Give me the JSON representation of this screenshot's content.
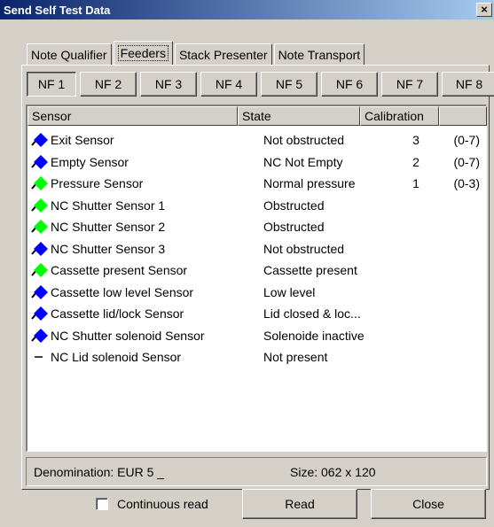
{
  "window": {
    "title": "Send Self Test Data",
    "close_glyph": "×"
  },
  "tabs": [
    {
      "label": "Note Qualifier",
      "active": false
    },
    {
      "label": "Feeders",
      "active": true
    },
    {
      "label": "Stack Presenter",
      "active": false
    },
    {
      "label": "Note Transport",
      "active": false
    }
  ],
  "feeders": [
    "NF 1",
    "NF 2",
    "NF 3",
    "NF 4",
    "NF 5",
    "NF 6",
    "NF 7",
    "NF 8"
  ],
  "selected_feeder": "NF 1",
  "columns": {
    "sensor": "Sensor",
    "state": "State",
    "calibration": "Calibration",
    "extra": ""
  },
  "rows": [
    {
      "icon": "blue-diamond-icon",
      "sensor": "Exit Sensor",
      "state": "Not obstructed",
      "calibration": "3",
      "range": "(0-7)"
    },
    {
      "icon": "blue-diamond-icon",
      "sensor": "Empty Sensor",
      "state": "NC Not Empty",
      "calibration": "2",
      "range": "(0-7)"
    },
    {
      "icon": "green-diamond-icon",
      "sensor": "Pressure Sensor",
      "state": "Normal pressure",
      "calibration": "1",
      "range": "(0-3)"
    },
    {
      "icon": "green-diamond-icon",
      "sensor": "NC Shutter Sensor 1",
      "state": "Obstructed",
      "calibration": "",
      "range": ""
    },
    {
      "icon": "green-diamond-icon",
      "sensor": "NC Shutter Sensor 2",
      "state": "Obstructed",
      "calibration": "",
      "range": ""
    },
    {
      "icon": "blue-diamond-icon",
      "sensor": "NC Shutter Sensor 3",
      "state": "Not obstructed",
      "calibration": "",
      "range": ""
    },
    {
      "icon": "green-diamond-icon",
      "sensor": "Cassette present Sensor",
      "state": "Cassette present",
      "calibration": "",
      "range": ""
    },
    {
      "icon": "blue-diamond-icon",
      "sensor": "Cassette low level Sensor",
      "state": "Low level",
      "calibration": "",
      "range": ""
    },
    {
      "icon": "blue-diamond-icon",
      "sensor": "Cassette lid/lock Sensor",
      "state": "Lid closed & loc...",
      "calibration": "",
      "range": ""
    },
    {
      "icon": "blue-diamond-icon",
      "sensor": "NC Shutter solenoid Sensor",
      "state": "Solenoide inactive",
      "calibration": "",
      "range": ""
    },
    {
      "icon": "dash-icon",
      "sensor": "NC Lid solenoid Sensor",
      "state": "Not present",
      "calibration": "",
      "range": ""
    }
  ],
  "status": {
    "denomination": "Denomination: EUR 5 _",
    "size": "Size: 062  x  120"
  },
  "footer": {
    "continuous_read_label": "Continuous read",
    "continuous_read_checked": false,
    "read_label": "Read",
    "close_label": "Close"
  },
  "colors": {
    "blue_state": "#0000ff",
    "green_state": "#00ff00",
    "titlebar_start": "#0a246a",
    "titlebar_end": "#a6caf0",
    "face": "#d4d0c8"
  }
}
